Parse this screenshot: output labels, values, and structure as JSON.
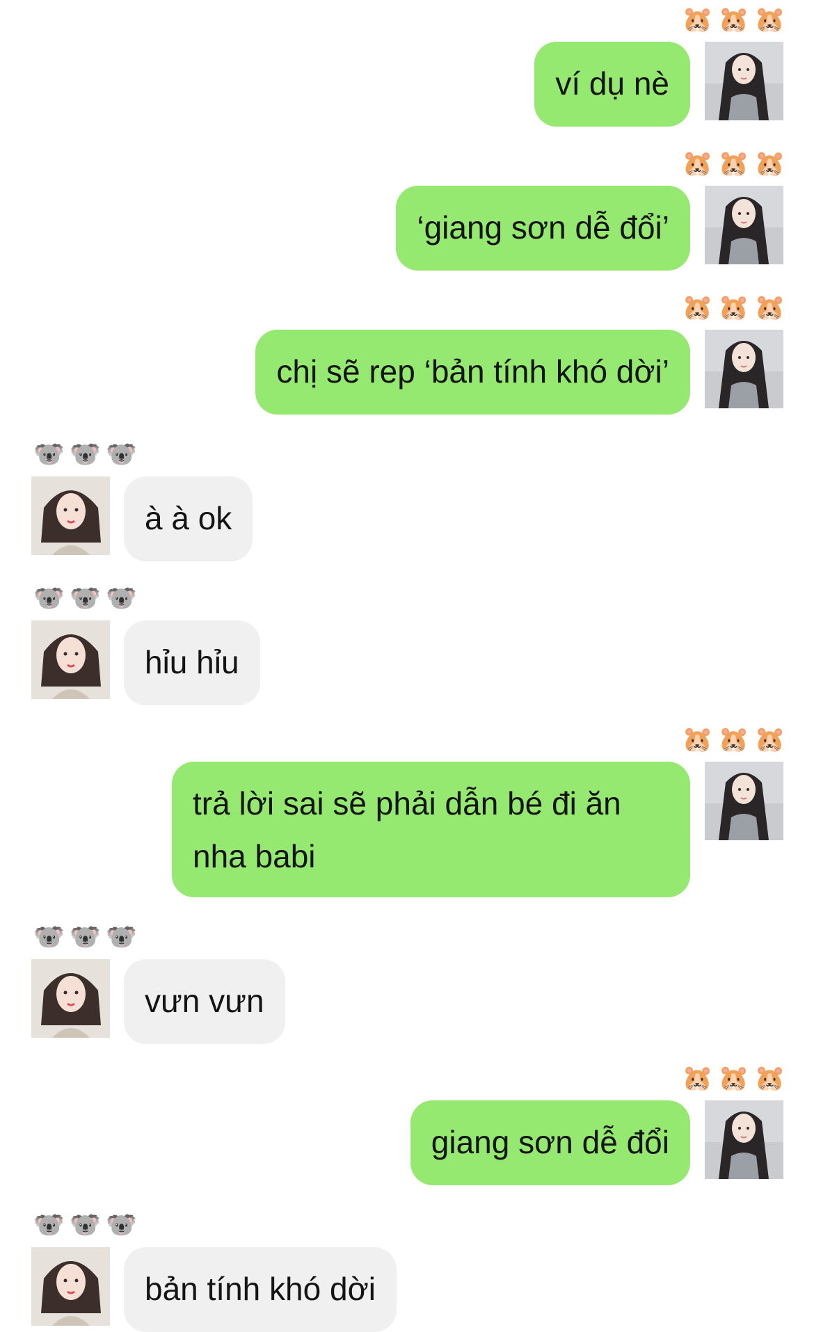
{
  "reactions": {
    "outgoing": [
      "🐹",
      "🐹",
      "🐹"
    ],
    "incoming": [
      "🐨",
      "🐨",
      "🐨"
    ]
  },
  "avatars": {
    "me": "avatar-long-hair",
    "other": "avatar-short-hair"
  },
  "colors": {
    "outgoing_bubble": "#95e870",
    "incoming_bubble": "#f0f0f0",
    "text": "#141414",
    "background": "#ffffff"
  },
  "messages": [
    {
      "side": "out",
      "text": "ví dụ nè"
    },
    {
      "side": "out",
      "text": "‘giang sơn dễ đổi’"
    },
    {
      "side": "out",
      "text": "chị sẽ rep ‘bản tính khó dời’"
    },
    {
      "side": "in",
      "text": "à à ok"
    },
    {
      "side": "in",
      "text": "hỉu hỉu"
    },
    {
      "side": "out",
      "text": "trả lời sai sẽ phải dẫn bé đi ăn nha babi"
    },
    {
      "side": "in",
      "text": "vưn vưn"
    },
    {
      "side": "out",
      "text": "giang sơn dễ đổi"
    },
    {
      "side": "in",
      "text": "bản tính khó dời"
    }
  ]
}
